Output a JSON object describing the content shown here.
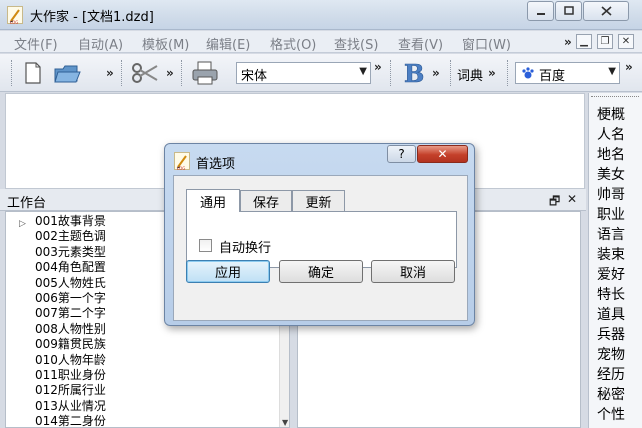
{
  "window": {
    "title": "大作家 - [文档1.dzd]",
    "minimize_icon": "minimize-icon",
    "maximize_icon": "maximize-icon",
    "close_icon": "close-icon"
  },
  "menubar": {
    "items": [
      "文件(F)",
      "自动(A)",
      "模板(M)",
      "编辑(E)",
      "格式(O)",
      "查找(S)",
      "查看(V)",
      "窗口(W)"
    ],
    "overflow": "»"
  },
  "toolbar": {
    "overflow": "»",
    "font": "宋体",
    "dict_label": "词典",
    "search_engine": "百度"
  },
  "right_list": {
    "items": [
      "梗概",
      "人名",
      "地名",
      "美女",
      "帅哥",
      "职业",
      "语言",
      "装束",
      "爱好",
      "特长",
      "道具",
      "兵器",
      "宠物",
      "经历",
      "秘密",
      "个性"
    ]
  },
  "workspace": {
    "title": "工作台",
    "tree_items": [
      "001故事背景",
      "002主题色调",
      "003元素类型",
      "004角色配置",
      "005人物姓氏",
      "006第一个字",
      "007第二个字",
      "008人物性别",
      "009籍贯民族",
      "010人物年龄",
      "011职业身份",
      "012所属行业",
      "013从业情况",
      "014第二身份"
    ]
  },
  "dialog": {
    "title": "首选项",
    "help_label": "?",
    "close_label": "✕",
    "tabs": [
      "通用",
      "保存",
      "更新"
    ],
    "active_tab": "通用",
    "checkbox_label": "自动换行",
    "checkbox_checked": false,
    "buttons": {
      "apply": "应用",
      "ok": "确定",
      "cancel": "取消"
    }
  }
}
